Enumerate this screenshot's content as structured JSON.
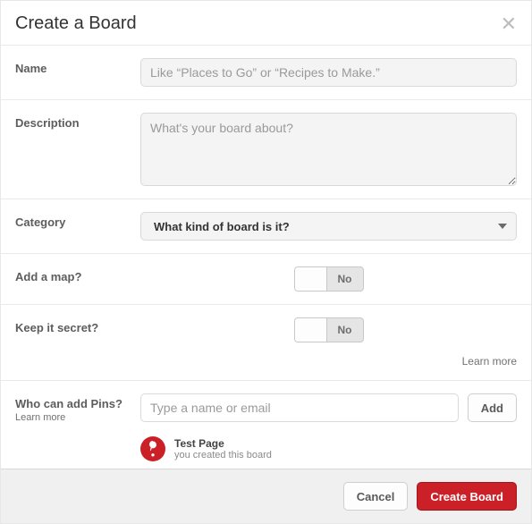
{
  "header": {
    "title": "Create a Board"
  },
  "fields": {
    "name": {
      "label": "Name",
      "placeholder": "Like “Places to Go” or “Recipes to Make.”"
    },
    "description": {
      "label": "Description",
      "placeholder": "What's your board about?"
    },
    "category": {
      "label": "Category",
      "placeholder": "What kind of board is it?"
    },
    "map": {
      "label": "Add a map?",
      "state": "No"
    },
    "secret": {
      "label": "Keep it secret?",
      "state": "No",
      "learn": "Learn more"
    },
    "pins": {
      "label": "Who can add Pins?",
      "learn": "Learn more",
      "placeholder": "Type a name or email",
      "add": "Add"
    }
  },
  "member": {
    "name": "Test Page",
    "meta": "you created this board"
  },
  "footer": {
    "cancel": "Cancel",
    "create": "Create Board"
  }
}
